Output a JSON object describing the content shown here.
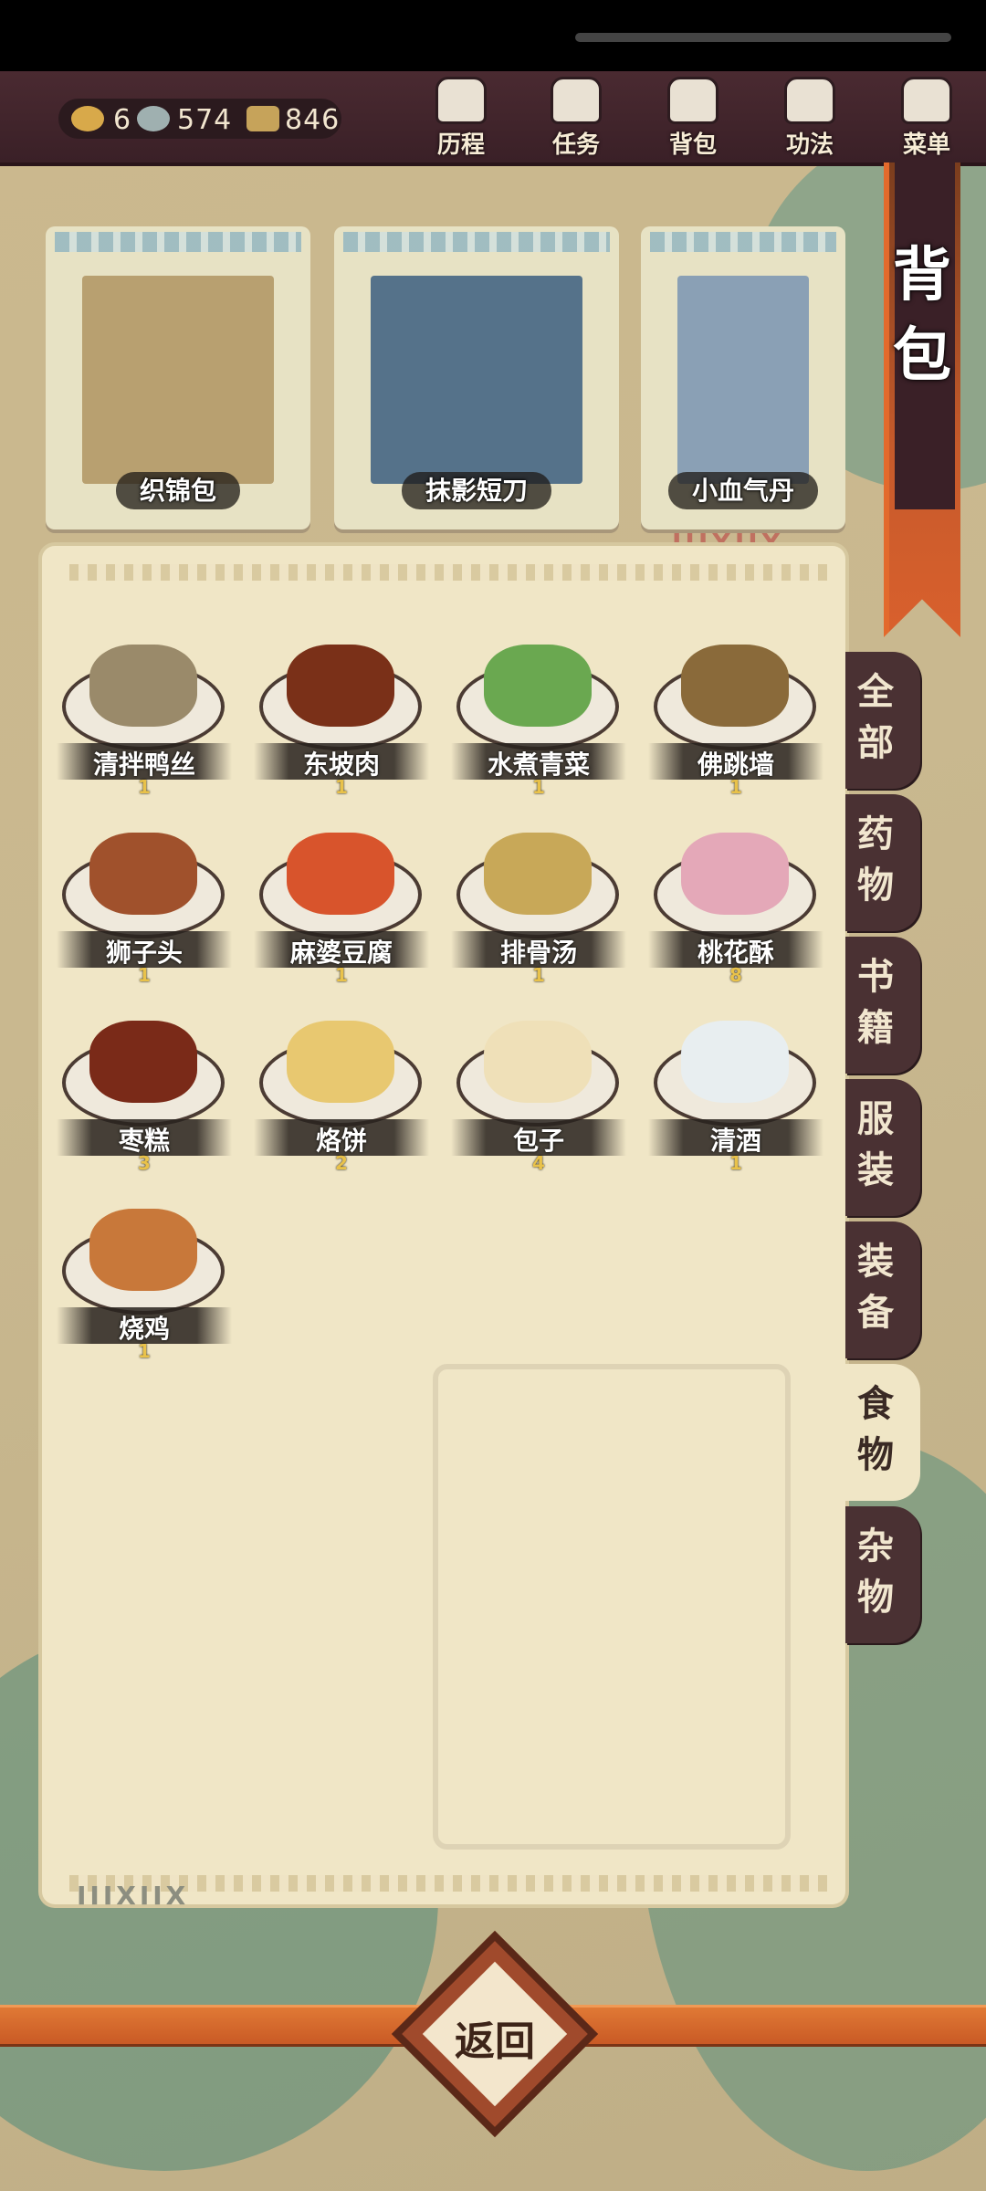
{
  "resources": [
    {
      "icon": "ingot-icon",
      "value": "6",
      "color": "#d8a94a"
    },
    {
      "icon": "jade-icon",
      "value": "574",
      "color": "#9fb0b0"
    },
    {
      "icon": "coin-icon",
      "value": "846",
      "color": "#c6a35a"
    }
  ],
  "menu": [
    {
      "label": "历程",
      "icon": "scroll-bundle-icon"
    },
    {
      "label": "任务",
      "icon": "task-icon"
    },
    {
      "label": "背包",
      "icon": "bag-icon"
    },
    {
      "label": "功法",
      "icon": "book-icon"
    },
    {
      "label": "菜单",
      "icon": "fan-icon"
    }
  ],
  "banner": {
    "title": "背包"
  },
  "equipped": [
    {
      "name": "织锦包",
      "color": "#b8a070"
    },
    {
      "name": "抹影短刀",
      "color": "#55728a"
    },
    {
      "name": "小血气丹",
      "color": "#8aa0b5"
    }
  ],
  "items": [
    {
      "name": "清拌鸭丝",
      "count": "1",
      "color": "#9a8a6a"
    },
    {
      "name": "东坡肉",
      "count": "1",
      "color": "#7a3018"
    },
    {
      "name": "水煮青菜",
      "count": "1",
      "color": "#6aa850"
    },
    {
      "name": "佛跳墙",
      "count": "1",
      "color": "#8a6a3a"
    },
    {
      "name": "狮子头",
      "count": "1",
      "color": "#a0512c"
    },
    {
      "name": "麻婆豆腐",
      "count": "1",
      "color": "#d8542c"
    },
    {
      "name": "排骨汤",
      "count": "1",
      "color": "#c8a858"
    },
    {
      "name": "桃花酥",
      "count": "8",
      "color": "#e4a8b8"
    },
    {
      "name": "枣糕",
      "count": "3",
      "color": "#7a2a18"
    },
    {
      "name": "烙饼",
      "count": "2",
      "color": "#e8c870"
    },
    {
      "name": "包子",
      "count": "4",
      "color": "#efe0b8"
    },
    {
      "name": "清酒",
      "count": "1",
      "color": "#e8eef0"
    },
    {
      "name": "烧鸡",
      "count": "1",
      "color": "#c8783a"
    }
  ],
  "tabs": [
    {
      "label": "全部"
    },
    {
      "label": "药物"
    },
    {
      "label": "书籍"
    },
    {
      "label": "服装"
    },
    {
      "label": "装备"
    },
    {
      "label": "食物"
    },
    {
      "label": "杂物"
    }
  ],
  "active_tab": "食物",
  "deco_marks": "IIIXIIX",
  "back": {
    "label": "返回"
  }
}
